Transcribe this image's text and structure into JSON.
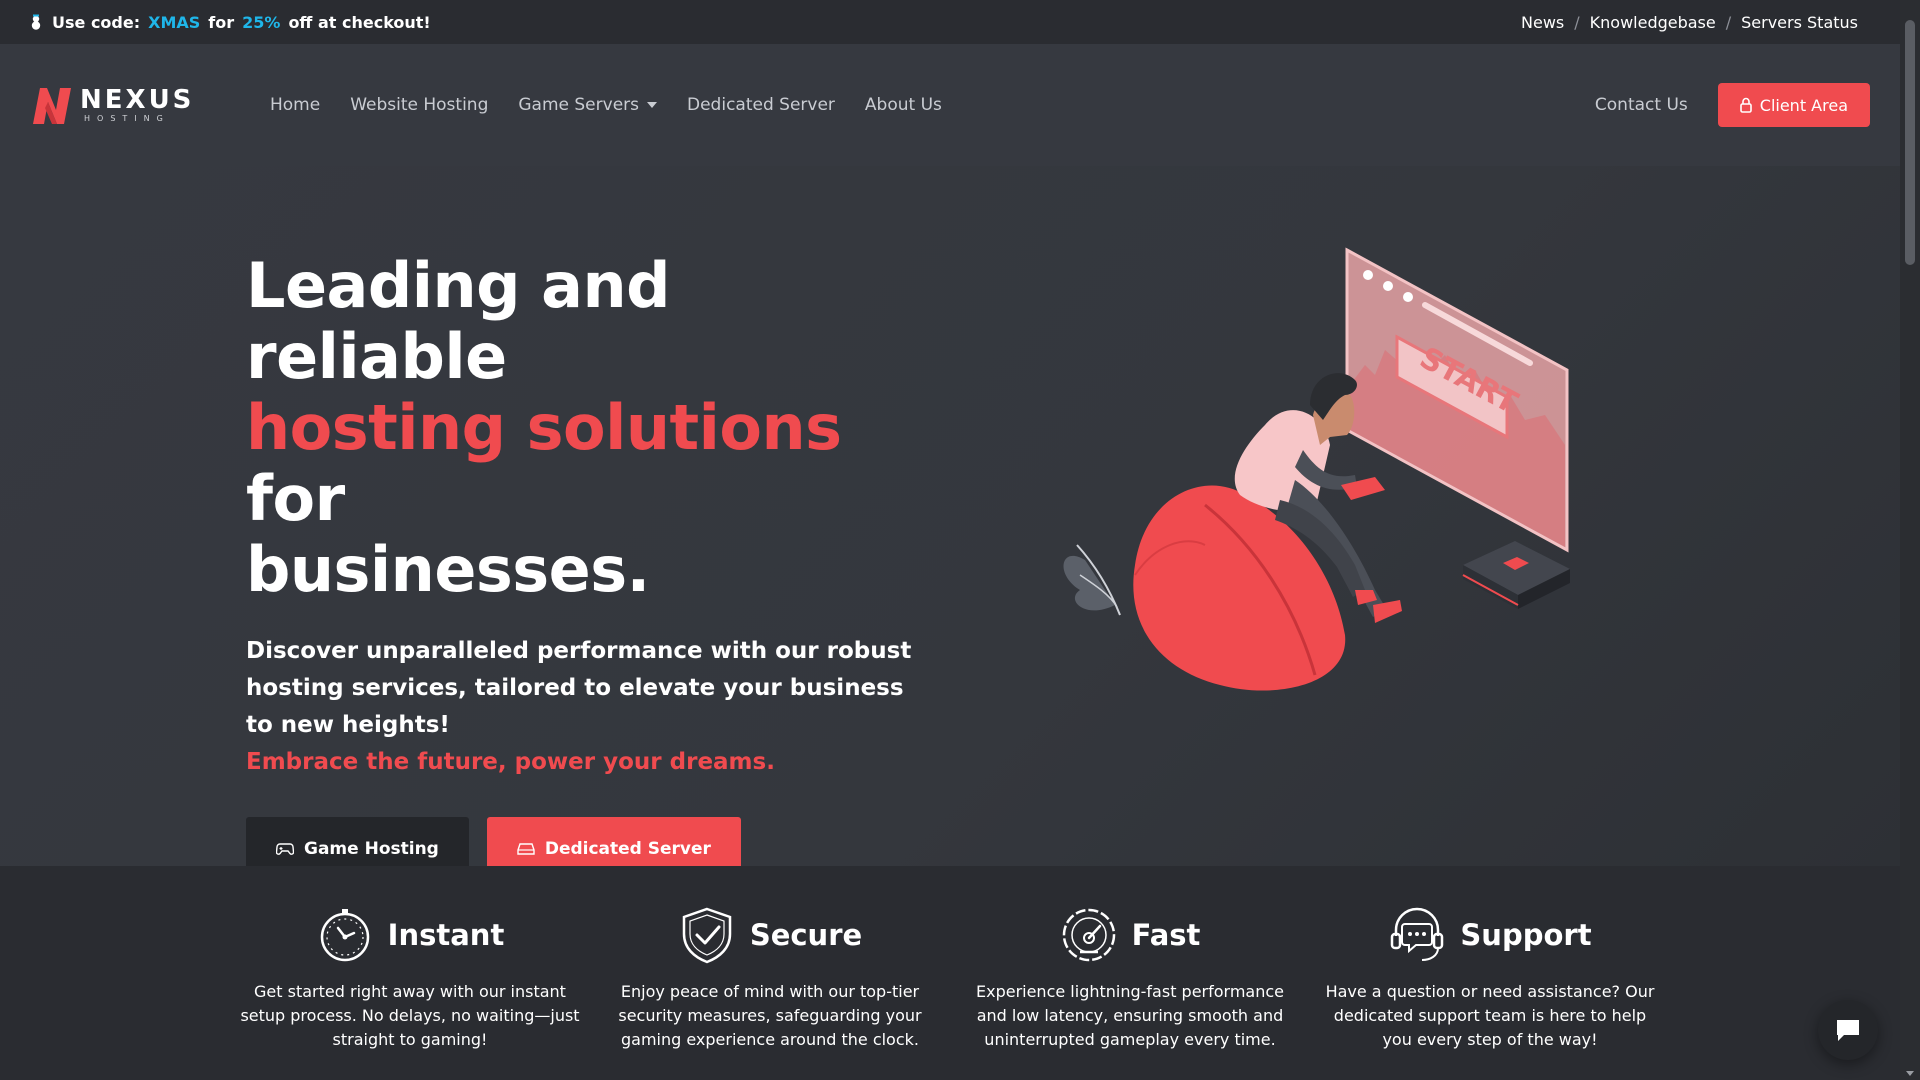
{
  "promo": {
    "prefix": "Use code:",
    "code": "XMAS",
    "mid": "for",
    "discount": "25%",
    "suffix": "off at checkout!",
    "icon": "snowman-icon"
  },
  "top_links": [
    "News",
    "Knowledgebase",
    "Servers Status"
  ],
  "logo": {
    "name": "NEXUS",
    "sub": "HOSTING"
  },
  "nav": {
    "items": [
      "Home",
      "Website Hosting",
      "Game Servers",
      "Dedicated Server",
      "About Us"
    ],
    "contact": "Contact Us",
    "client_area": "Client Area"
  },
  "hero": {
    "title_line1": "Leading and reliable",
    "title_highlight": "hosting solutions",
    "title_line2_end": "for",
    "title_line3": "businesses.",
    "description": "Discover unparalleled performance with our robust hosting services, tailored to elevate your business to new heights!",
    "tagline": "Embrace the future, power your dreams.",
    "btn_game": "Game Hosting",
    "btn_dedicated": "Dedicated Server",
    "illustration_text": "START"
  },
  "features": [
    {
      "title": "Instant",
      "icon": "stopwatch-icon",
      "desc": "Get started right away with our instant setup process. No delays, no waiting—just straight to gaming!"
    },
    {
      "title": "Secure",
      "icon": "shield-check-icon",
      "desc": "Enjoy peace of mind with our top-tier security measures, safeguarding your gaming experience around the clock."
    },
    {
      "title": "Fast",
      "icon": "speedometer-icon",
      "desc": "Experience lightning-fast performance and low latency, ensuring smooth and uninterrupted gameplay every time."
    },
    {
      "title": "Support",
      "icon": "headset-icon",
      "desc": "Have a question or need assistance? Our dedicated support team is here to help you every step of the way!"
    }
  ],
  "colors": {
    "accent": "#f04b4f",
    "promo_highlight": "#1fb6e9",
    "background": "#363940",
    "bar": "#2a2c31"
  }
}
